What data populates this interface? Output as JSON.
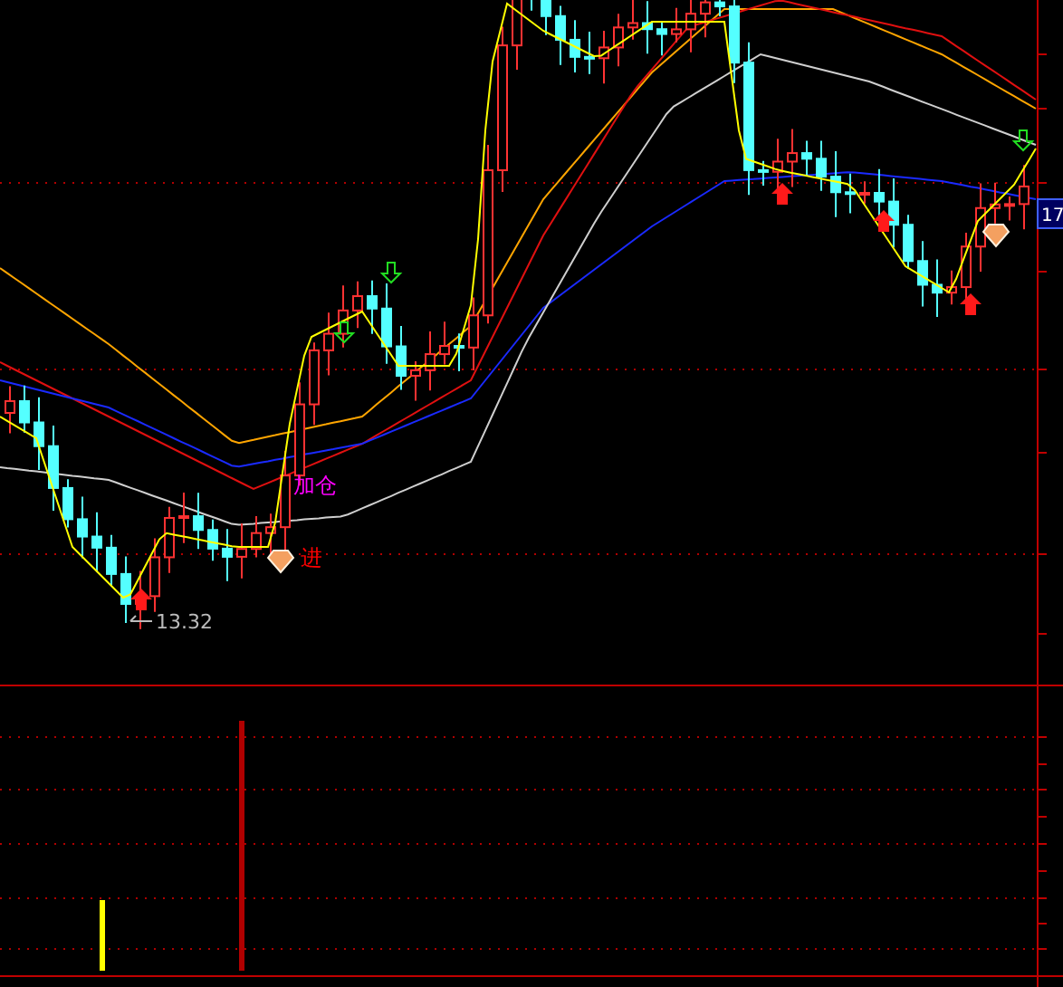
{
  "main_chart": {
    "price_label": "17",
    "low_label": "13.32",
    "signals": [
      {
        "text": "加仓",
        "color": "#ff00ff"
      },
      {
        "text": "进",
        "color": "#ff0000"
      }
    ]
  }
}
